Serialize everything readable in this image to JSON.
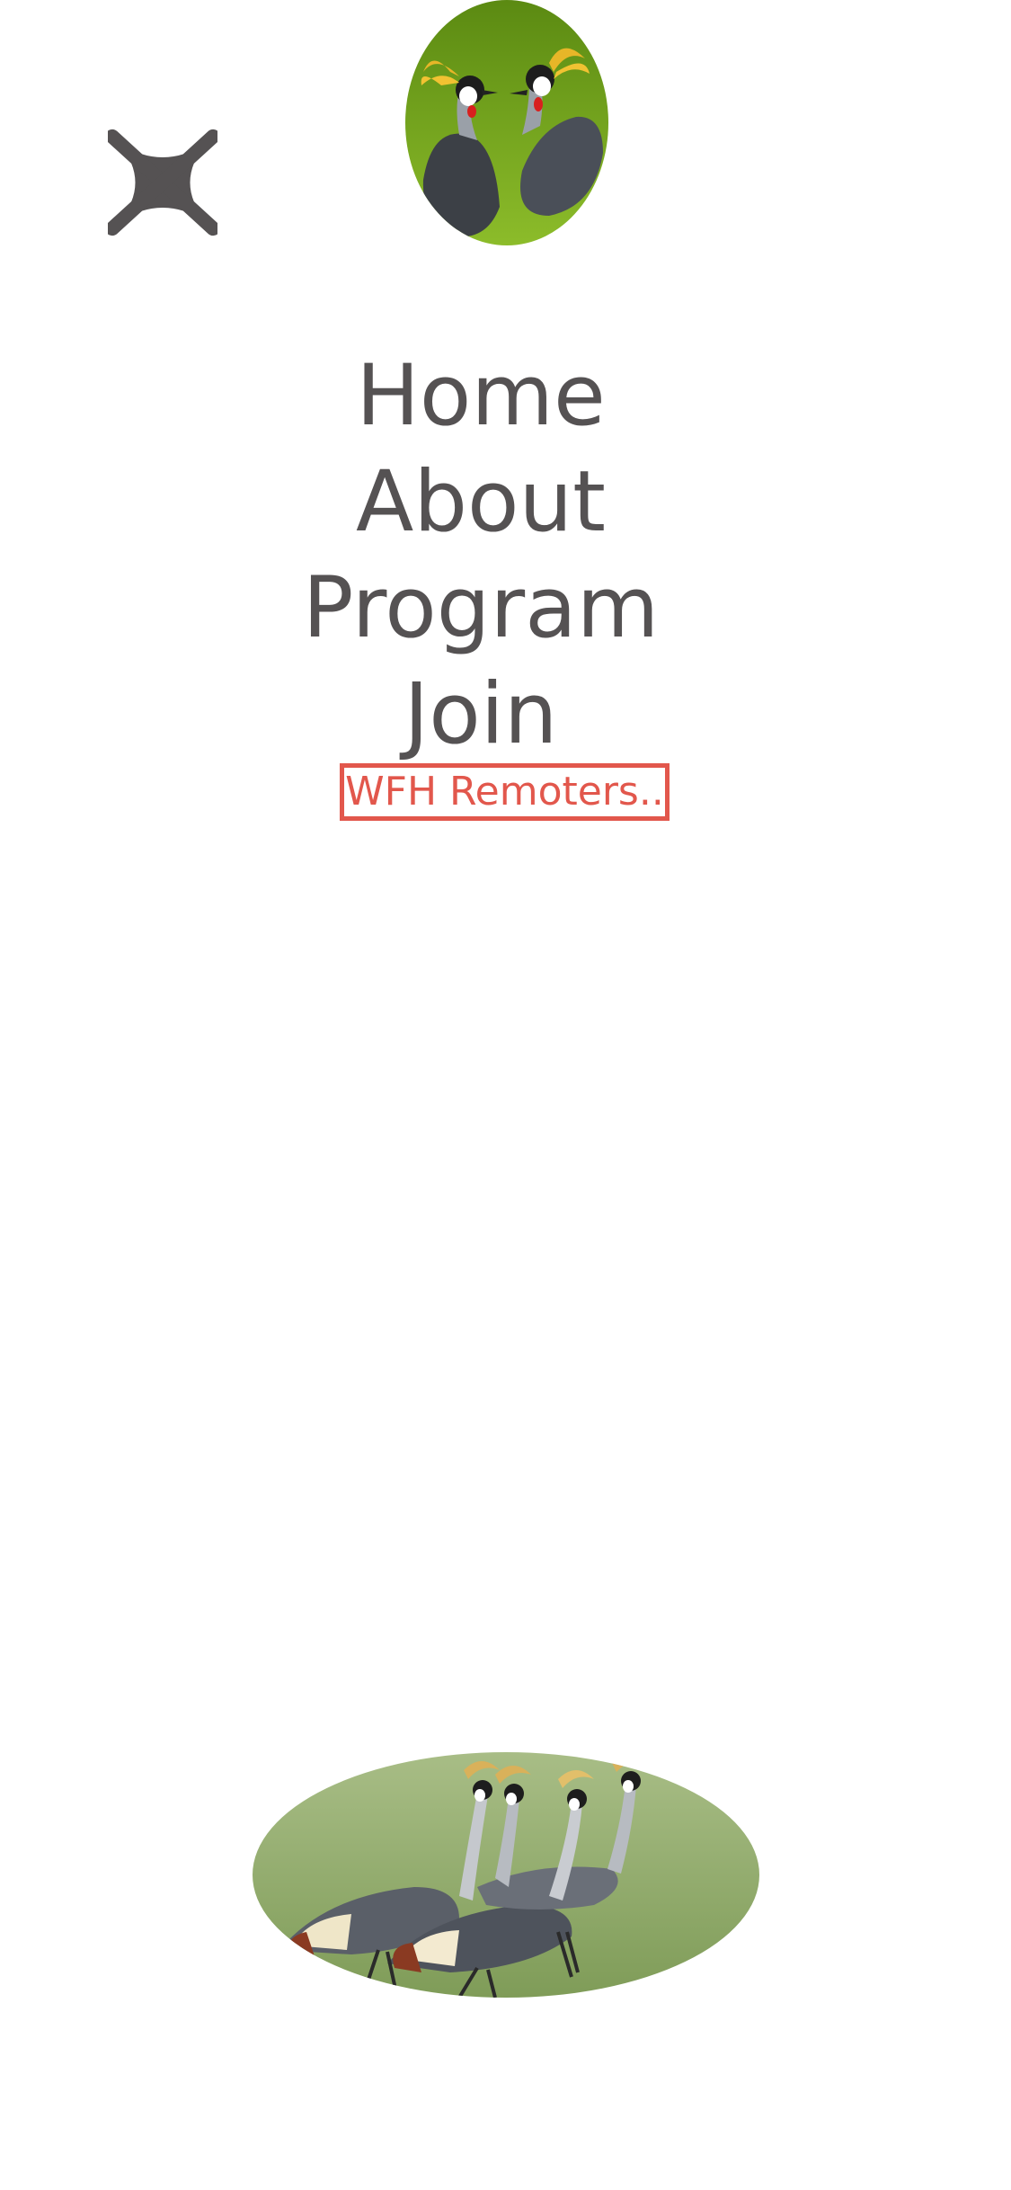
{
  "menu": {
    "close_icon": "close-icon",
    "items": [
      {
        "label": "Home"
      },
      {
        "label": "About"
      },
      {
        "label": "Program"
      },
      {
        "label": "Join"
      }
    ],
    "highlight_link": {
      "label": "WFH Remoters.."
    }
  },
  "images": {
    "header_photo": "crowned-cranes-pair-photo",
    "footer_photo": "crowned-cranes-flock-photo"
  },
  "colors": {
    "text": "#555253",
    "accent": "#e2574c",
    "background": "#ffffff"
  }
}
